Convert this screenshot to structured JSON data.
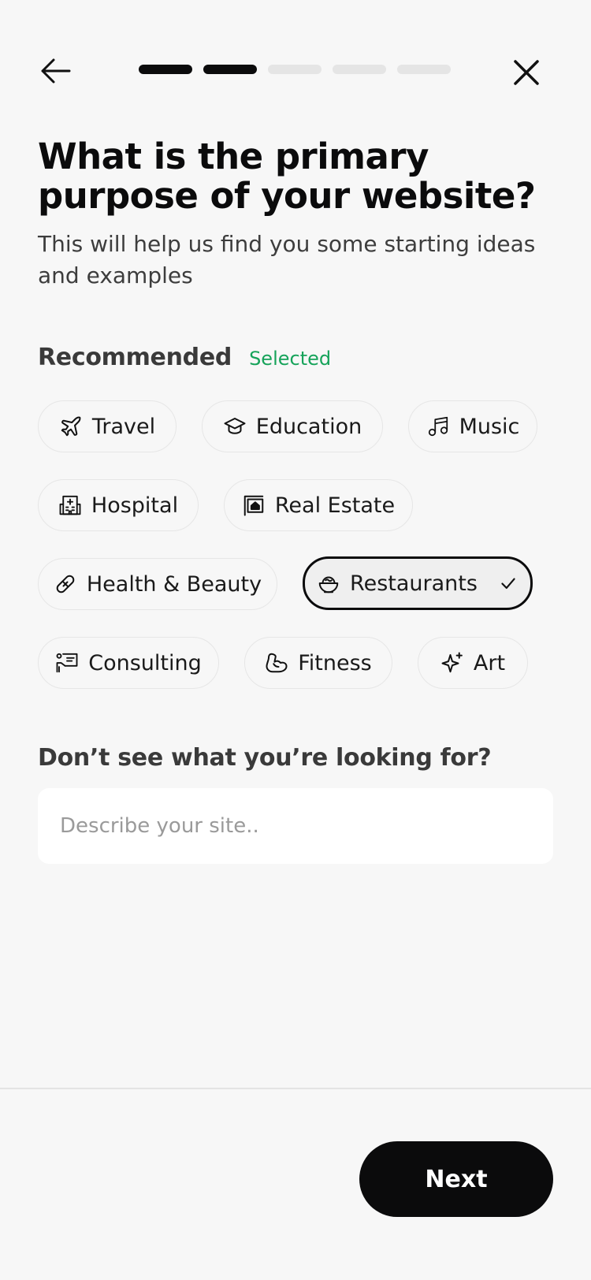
{
  "header": {
    "progress": {
      "total_steps": 5,
      "completed_steps": 2
    }
  },
  "title": "What is the primary purpose of your website?",
  "subtitle": "This will help us find you some starting ideas and examples",
  "recommended": {
    "title": "Recommended",
    "selected_label": "Selected",
    "categories": [
      {
        "label": "Travel",
        "icon": "airplane-icon",
        "selected": false
      },
      {
        "label": "Education",
        "icon": "graduation-cap-icon",
        "selected": false
      },
      {
        "label": "Music",
        "icon": "music-note-icon",
        "selected": false
      },
      {
        "label": "Hospital",
        "icon": "hospital-icon",
        "selected": false
      },
      {
        "label": "Real Estate",
        "icon": "house-sign-icon",
        "selected": false
      },
      {
        "label": "Health & Beauty",
        "icon": "bandage-icon",
        "selected": false
      },
      {
        "label": "Restaurants",
        "icon": "food-bowl-icon",
        "selected": true
      },
      {
        "label": "Consulting",
        "icon": "presentation-icon",
        "selected": false
      },
      {
        "label": "Fitness",
        "icon": "flexed-arm-icon",
        "selected": false
      },
      {
        "label": "Art",
        "icon": "sparkle-icon",
        "selected": false
      }
    ]
  },
  "custom": {
    "label": "Don’t see what you’re looking for?",
    "placeholder": "Describe your site..",
    "value": ""
  },
  "footer": {
    "next_label": "Next"
  },
  "colors": {
    "accent": "#0b0b0c",
    "selected_text": "#16a35a",
    "background": "#f7f7f7",
    "progress_inactive": "#e5e5e5"
  }
}
